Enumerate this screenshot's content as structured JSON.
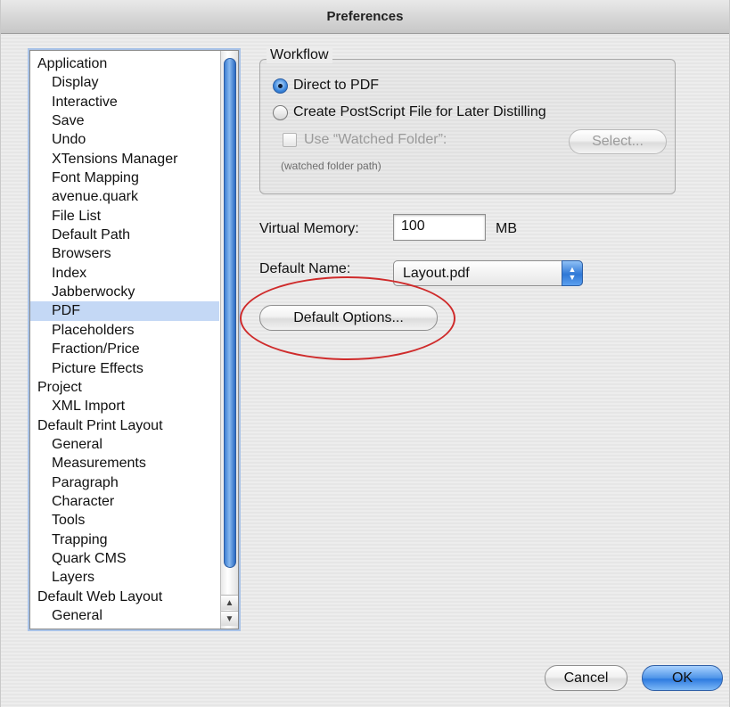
{
  "window": {
    "title": "Preferences"
  },
  "sidebar": {
    "items": [
      {
        "label": "Application",
        "level": 0,
        "selected": false
      },
      {
        "label": "Display",
        "level": 1,
        "selected": false
      },
      {
        "label": "Interactive",
        "level": 1,
        "selected": false
      },
      {
        "label": "Save",
        "level": 1,
        "selected": false
      },
      {
        "label": "Undo",
        "level": 1,
        "selected": false
      },
      {
        "label": "XTensions Manager",
        "level": 1,
        "selected": false
      },
      {
        "label": "Font Mapping",
        "level": 1,
        "selected": false
      },
      {
        "label": "avenue.quark",
        "level": 1,
        "selected": false
      },
      {
        "label": "File List",
        "level": 1,
        "selected": false
      },
      {
        "label": "Default Path",
        "level": 1,
        "selected": false
      },
      {
        "label": "Browsers",
        "level": 1,
        "selected": false
      },
      {
        "label": "Index",
        "level": 1,
        "selected": false
      },
      {
        "label": "Jabberwocky",
        "level": 1,
        "selected": false
      },
      {
        "label": "PDF",
        "level": 1,
        "selected": true
      },
      {
        "label": "Placeholders",
        "level": 1,
        "selected": false
      },
      {
        "label": "Fraction/Price",
        "level": 1,
        "selected": false
      },
      {
        "label": "Picture Effects",
        "level": 1,
        "selected": false
      },
      {
        "label": "Project",
        "level": 0,
        "selected": false
      },
      {
        "label": "XML Import",
        "level": 1,
        "selected": false
      },
      {
        "label": "Default Print Layout",
        "level": 0,
        "selected": false
      },
      {
        "label": "General",
        "level": 1,
        "selected": false
      },
      {
        "label": "Measurements",
        "level": 1,
        "selected": false
      },
      {
        "label": "Paragraph",
        "level": 1,
        "selected": false
      },
      {
        "label": "Character",
        "level": 1,
        "selected": false
      },
      {
        "label": "Tools",
        "level": 1,
        "selected": false
      },
      {
        "label": "Trapping",
        "level": 1,
        "selected": false
      },
      {
        "label": "Quark CMS",
        "level": 1,
        "selected": false
      },
      {
        "label": "Layers",
        "level": 1,
        "selected": false
      },
      {
        "label": "Default Web Layout",
        "level": 0,
        "selected": false
      },
      {
        "label": "General",
        "level": 1,
        "selected": false
      }
    ],
    "scroll_up_icon": "up-triangle-icon",
    "scroll_down_icon": "down-triangle-icon"
  },
  "workflow": {
    "title": "Workflow",
    "option_direct": "Direct to PDF",
    "option_postscript": "Create PostScript File for Later Distilling",
    "selected": "direct",
    "watched_folder_label": "Use “Watched Folder”:",
    "watched_folder_checked": false,
    "select_button": "Select...",
    "folder_path": "(watched folder path)"
  },
  "virtual_memory": {
    "label": "Virtual Memory:",
    "value": "100",
    "unit": "MB"
  },
  "default_name": {
    "label": "Default Name:",
    "value": "Layout.pdf"
  },
  "default_options_button": "Default Options...",
  "highlight_color": "#cf2b2b",
  "footer": {
    "cancel": "Cancel",
    "ok": "OK"
  }
}
